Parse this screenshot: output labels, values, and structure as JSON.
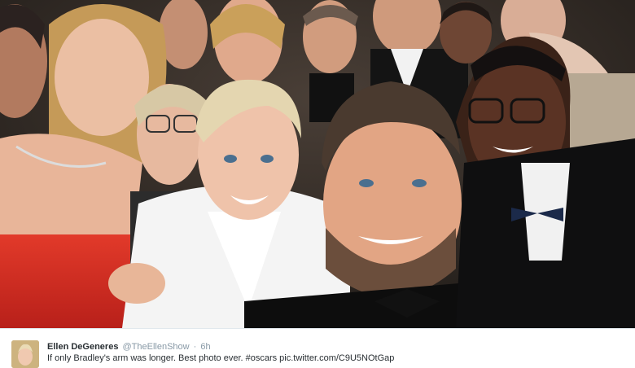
{
  "tweet": {
    "author_name": "Ellen DeGeneres",
    "author_handle": "@TheEllenShow",
    "separator": "·",
    "time": "6h",
    "text": "If only Bradley's arm was longer. Best photo ever. #oscars pic.twitter.com/C9U5NOtGap"
  },
  "photo": {
    "subject": "group-selfie"
  },
  "colors": {
    "name": "#292f33",
    "meta": "#8899a6",
    "background": "#ffffff",
    "divider": "#e1e8ed"
  }
}
